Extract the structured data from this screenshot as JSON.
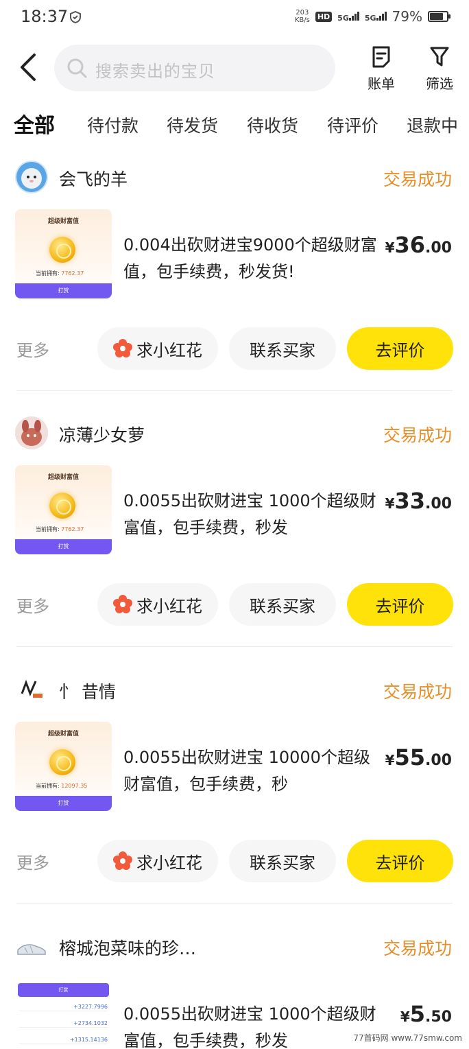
{
  "status_bar": {
    "time": "18:37",
    "net_speed_top": "203",
    "net_speed_bottom": "KB/s",
    "hd": "HD",
    "sim1": "5G",
    "sim2": "5G",
    "battery_pct": "79%",
    "battery_level": 0.79
  },
  "header": {
    "search_placeholder": "搜索卖出的宝贝",
    "bill_label": "账单",
    "filter_label": "筛选"
  },
  "tabs": [
    "全部",
    "待付款",
    "待发货",
    "待收货",
    "待评价",
    "退款中"
  ],
  "active_tab": 0,
  "orders": [
    {
      "seller": "会飞的羊",
      "status": "交易成功",
      "thumb_title": "超级财富值",
      "thumb_balance_label": "当前拥有:",
      "thumb_balance": "7762.37",
      "thumb_button": "打赏",
      "title": "0.004出砍财进宝9000个超级财富值，包手续费，秒发货!",
      "price_currency": "¥",
      "price_int": "36",
      "price_dec": ".00",
      "more": "更多",
      "btn_flower": "求小红花",
      "btn_contact": "联系买家",
      "btn_review": "去评价"
    },
    {
      "seller": "凉薄少女萝",
      "status": "交易成功",
      "thumb_title": "超级财富值",
      "thumb_balance_label": "当前拥有:",
      "thumb_balance": "7762.37",
      "thumb_button": "打赏",
      "title": "0.0055出砍财进宝 1000个超级财富值，包手续费，秒发",
      "price_currency": "¥",
      "price_int": "33",
      "price_dec": ".00",
      "more": "更多",
      "btn_flower": "求小红花",
      "btn_contact": "联系买家",
      "btn_review": "去评价"
    },
    {
      "seller": "忄 昔情",
      "status": "交易成功",
      "thumb_title": "超级财富值",
      "thumb_balance_label": "当前拥有:",
      "thumb_balance": "12097.35",
      "thumb_button": "打赏",
      "title": "0.0055出砍财进宝 10000个超级财富值，包手续费，秒",
      "price_currency": "¥",
      "price_int": "55",
      "price_dec": ".00",
      "more": "更多",
      "btn_flower": "求小红花",
      "btn_contact": "联系买家",
      "btn_review": "去评价"
    },
    {
      "seller": "榕城泡菜味的珍…",
      "status": "交易成功",
      "thumb_button": "打赏",
      "thumb_values": [
        "+3227.7996",
        "+2734.1032",
        "+1315.14136"
      ],
      "title": "0.0055出砍财进宝 1000个超级财富值，包手续费，秒发",
      "price_currency": "¥",
      "price_int": "5",
      "price_dec": ".50"
    }
  ],
  "watermark": "77首码网 www.77smw.com",
  "colors": {
    "accent_yellow": "#ffe20a",
    "status_orange": "#e7902a",
    "thumb_purple": "#7257f0"
  }
}
